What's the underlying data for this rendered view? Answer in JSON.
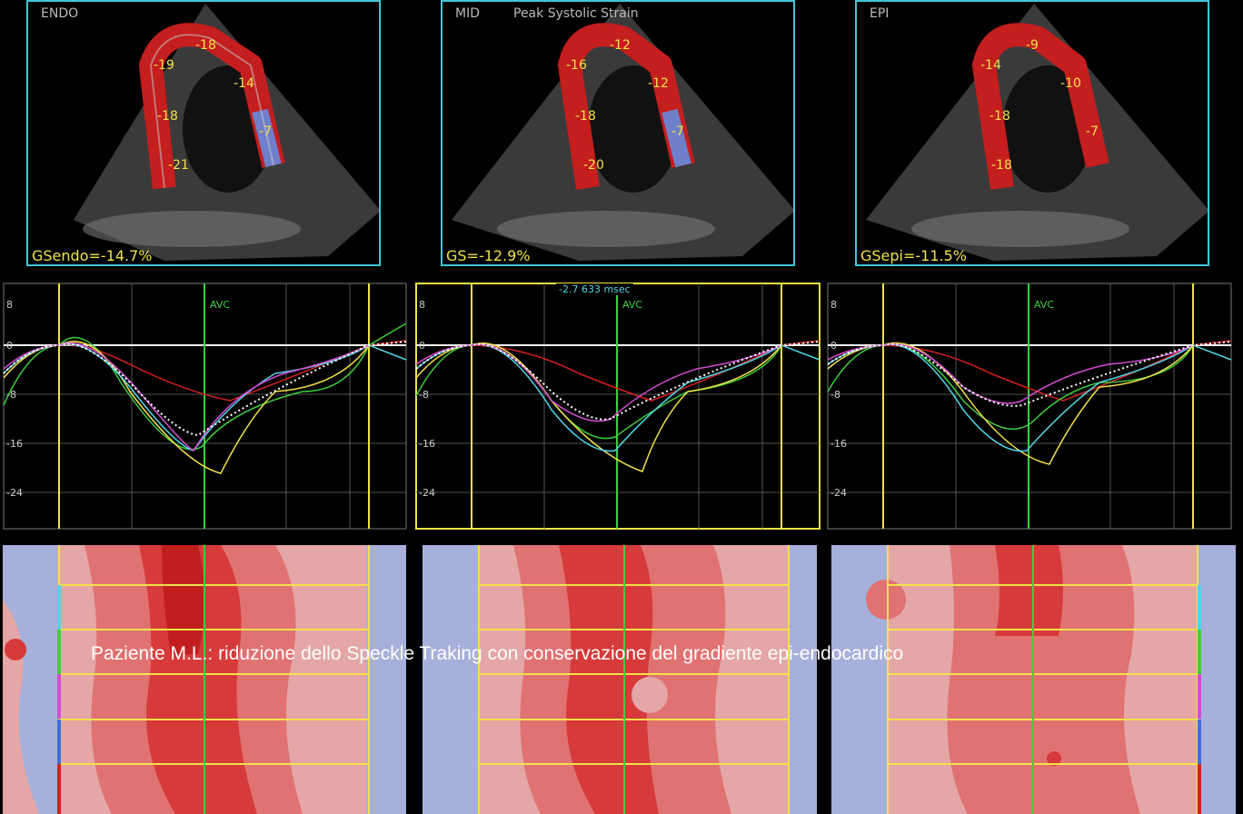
{
  "echo_panels": [
    {
      "id": "endo",
      "label": "ENDO",
      "title": "",
      "gs": "GSendo=-14.7%",
      "segments": [
        "-18",
        "-19",
        "-14",
        "-18",
        "-7",
        "-21"
      ]
    },
    {
      "id": "mid",
      "label": "MID",
      "title": "Peak Systolic Strain",
      "gs": "GS=-12.9%",
      "segments": [
        "-12",
        "-16",
        "-12",
        "-18",
        "-7",
        "-20"
      ]
    },
    {
      "id": "epi",
      "label": "EPI",
      "title": "",
      "gs": "GSepi=-11.5%",
      "segments": [
        "-9",
        "-14",
        "-10",
        "-18",
        "-7",
        "-18"
      ]
    }
  ],
  "graphs": {
    "y_ticks": [
      "8",
      "0",
      "-8",
      "-16",
      "-24"
    ],
    "avc_label": "AVC",
    "cursor_readout": "-2.7  633 msec"
  },
  "colors": {
    "frame": "#3fc7d6",
    "yellow": "#f2e24a",
    "green": "#3ecf3e",
    "red": "#d42020",
    "heat_red": "#d73a3a",
    "heat_blue": "#9aa6d8"
  },
  "caption": "Paziente M.L.: riduzione dello Speckle Traking con conservazione del gradiente epi-endocardico"
}
